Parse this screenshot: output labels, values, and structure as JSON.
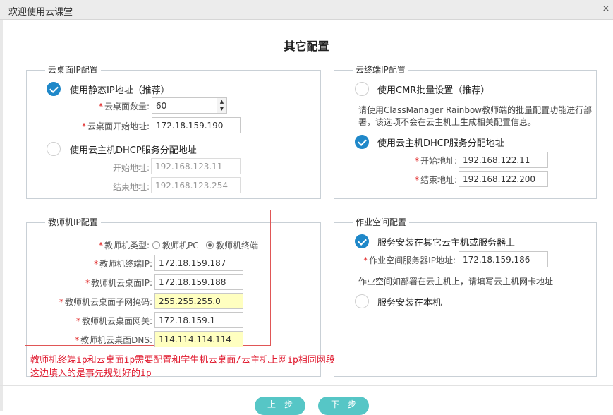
{
  "window": {
    "title": "欢迎使用云课堂"
  },
  "page": {
    "title": "其它配置"
  },
  "cloud_desktop_ip": {
    "title": "云桌面IP配置",
    "static_option": "使用静态IP地址（推荐）",
    "count_label": "云桌面数量",
    "count_value": "60",
    "start_label": "云桌面开始地址",
    "start_value": "172.18.159.190",
    "dhcp_option": "使用云主机DHCP服务分配地址",
    "dhcp_start_label": "开始地址",
    "dhcp_start_value": "192.168.123.11",
    "dhcp_end_label": "结束地址",
    "dhcp_end_value": "192.168.123.254"
  },
  "cloud_terminal_ip": {
    "title": "云终端IP配置",
    "cmr_option": "使用CMR批量设置（推荐）",
    "cmr_note_1": "请使用ClassManager Rainbow教师端的批量配置功能进行部",
    "cmr_note_2": "署，该选项不会在云主机上生成相关配置信息。",
    "dhcp_option": "使用云主机DHCP服务分配地址",
    "start_label": "开始地址",
    "start_value": "192.168.122.11",
    "end_label": "结束地址",
    "end_value": "192.168.122.200"
  },
  "teacher_ip": {
    "title": "教师机IP配置",
    "type_label": "教师机类型",
    "type_pc": "教师机PC",
    "type_terminal": "教师机终端",
    "terminal_ip_label": "教师机终端IP",
    "terminal_ip_value": "172.18.159.187",
    "desktop_ip_label": "教师机云桌面IP",
    "desktop_ip_value": "172.18.159.188",
    "mask_label": "教师机云桌面子网掩码",
    "mask_value": "255.255.255.0",
    "gateway_label": "教师机云桌面网关",
    "gateway_value": "172.18.159.1",
    "dns_label": "教师机云桌面DNS",
    "dns_value": "114.114.114.114"
  },
  "workspace": {
    "title": "作业空间配置",
    "other_option": "服务安装在其它云主机或服务器上",
    "server_ip_label": "作业空间服务器IP地址",
    "server_ip_value": "172.18.159.186",
    "note": "作业空间如部署在云主机上，请填写云主机网卡地址",
    "local_option": "服务安装在本机"
  },
  "annotation": {
    "line1": "教师机终端ip和云桌面ip需要配置和学生机云桌面/云主机上网ip相同网段",
    "line2": "这边填入的是事先规划好的ip"
  },
  "footer": {
    "prev": "上一步",
    "next": "下一步"
  },
  "colors": {
    "accent": "#1f88c9",
    "button": "#56c6c6",
    "required": "#e02020",
    "annotation": "#e0182d",
    "highlight": "#ffffc0"
  }
}
